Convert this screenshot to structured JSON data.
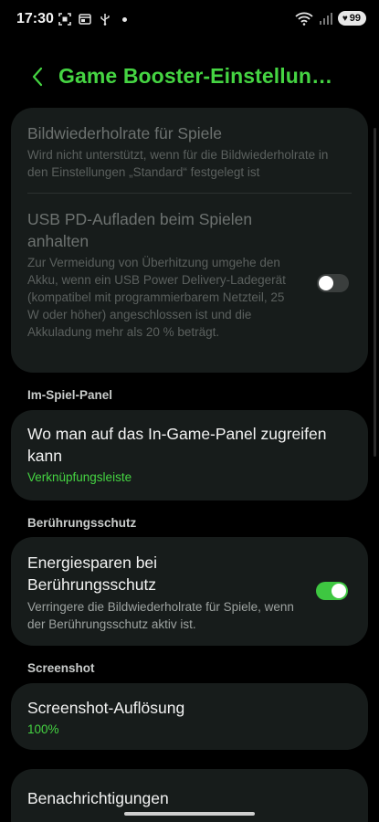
{
  "status_bar": {
    "time": "17:30",
    "battery_level": "99"
  },
  "header": {
    "title": "Game Booster-Einstellun…"
  },
  "settings_group_1": {
    "refresh_rate": {
      "title": "Bildwiederholrate für Spiele",
      "description": "Wird nicht unterstützt, wenn für die Bildwiederholrate in den Einstellungen „Standard“ festgelegt ist"
    },
    "usb_pd": {
      "title": "USB PD-Aufladen beim Spielen anhalten",
      "description": "Zur Vermeidung von Überhitzung umgehe den Akku, wenn ein USB Power Delivery-Ladegerät (kompatibel mit programmierbarem Netzteil, 25 W oder höher) angeschlossen ist und die Akkuladung mehr als 20 % beträgt.",
      "enabled": false
    }
  },
  "in_game_panel": {
    "section_title": "Im-Spiel-Panel",
    "access": {
      "title": "Wo man auf das In-Game-Panel zugreifen kann",
      "value": "Verknüpfungsleiste"
    }
  },
  "touch_protection": {
    "section_title": "Berührungsschutz",
    "power_saving": {
      "title": "Energiesparen bei Berührungsschutz",
      "description": "Verringere die Bildwiederholrate für Spiele, wenn der Berührungsschutz aktiv ist.",
      "enabled": true
    }
  },
  "screenshot": {
    "section_title": "Screenshot",
    "resolution": {
      "title": "Screenshot-Auflösung",
      "value": "100%"
    }
  },
  "notifications": {
    "title": "Benachrichtigungen"
  },
  "colors": {
    "accent": "#45d442",
    "card_background": "#171c1b",
    "toggle_on": "#3ec741"
  }
}
